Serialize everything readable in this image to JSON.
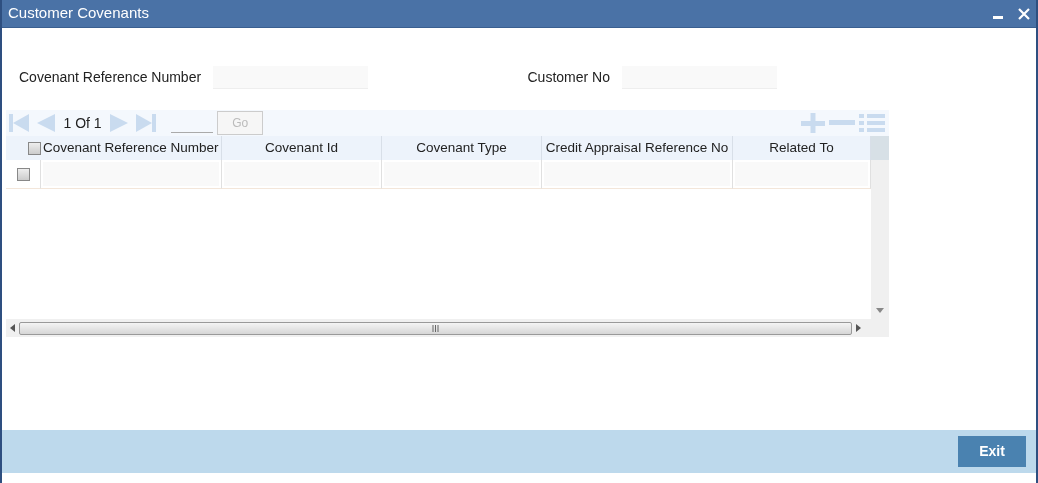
{
  "window": {
    "title": "Customer Covenants"
  },
  "fields": [
    {
      "label": "Covenant Reference Number"
    },
    {
      "label": "Customer No"
    }
  ],
  "grid": {
    "page_info": "1 Of 1",
    "go_label": "Go",
    "select_all_checked": false,
    "columns": [
      "Covenant Reference Number",
      "Covenant Id",
      "Covenant Type",
      "Credit Appraisal Reference No",
      "Related To"
    ],
    "rows": [
      {
        "checked": false
      }
    ]
  },
  "buttons": [
    "Exit"
  ]
}
